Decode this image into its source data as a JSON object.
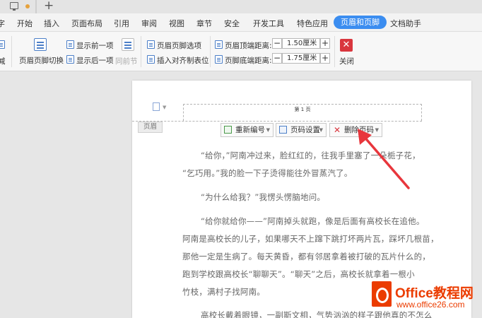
{
  "menu": {
    "items": [
      "字",
      "开始",
      "插入",
      "页面布局",
      "引用",
      "审阅",
      "视图",
      "章节",
      "安全",
      "开发工具",
      "特色应用",
      "页眉和页脚",
      "文档助手"
    ],
    "active": "页眉和页脚"
  },
  "ribbon": {
    "partial_left": "减",
    "switch_header_footer": "页眉页脚切换",
    "show_previous": "显示前一项",
    "show_next": "显示后一项",
    "same_as_previous": "同前节",
    "header_footer_options": "页眉页脚选项",
    "insert_alignment_tab": "插入对齐制表位",
    "header_top_distance_label": "页眉顶端距离:",
    "header_top_distance_value": "1.50厘米",
    "footer_bottom_distance_label": "页脚底端距离:",
    "footer_bottom_distance_value": "1.75厘米",
    "minus": "−",
    "plus": "+",
    "close": "关闭"
  },
  "document": {
    "page_number_text": "第 1 页",
    "header_label": "页眉",
    "buttons": {
      "renumber": "重新编号",
      "page_number_settings": "页码设置",
      "delete_page_number": "删除页码"
    },
    "lines": [
      "“给你，”阿南冲过来，脸红红的，往我手里塞了一朵栀子花，",
      "“乞巧用。”我的脸一下子烫得能往外冒蒸汽了。",
      "“为什么给我？”我愣头愣脑地问。",
      "“给你就给你——”阿南掉头就跑，像是后面有高校长在追他。",
      "阿南是高校长的儿子，如果哪天不上蹿下跳打坏两片瓦，踩坏几根苗，",
      "那他一定是生病了。每天黄昏，都有邻居拿着被打破的瓦片什么的，",
      "跑到学校跟高校长“聊聊天”。“聊天”之后，高校长就拿着一根小",
      "竹枝，满村子找阿南。",
      "高校长戴着眼镜，一副斯文相，气势汹汹的样子跟他真的不怎么"
    ]
  },
  "watermark": {
    "brand": "Office教程网",
    "url": "www.office26.com"
  },
  "colors": {
    "accent": "#3b8df0",
    "arrow": "#e8363c",
    "close_button": "#d9363e",
    "logo": "#eb3c00"
  }
}
